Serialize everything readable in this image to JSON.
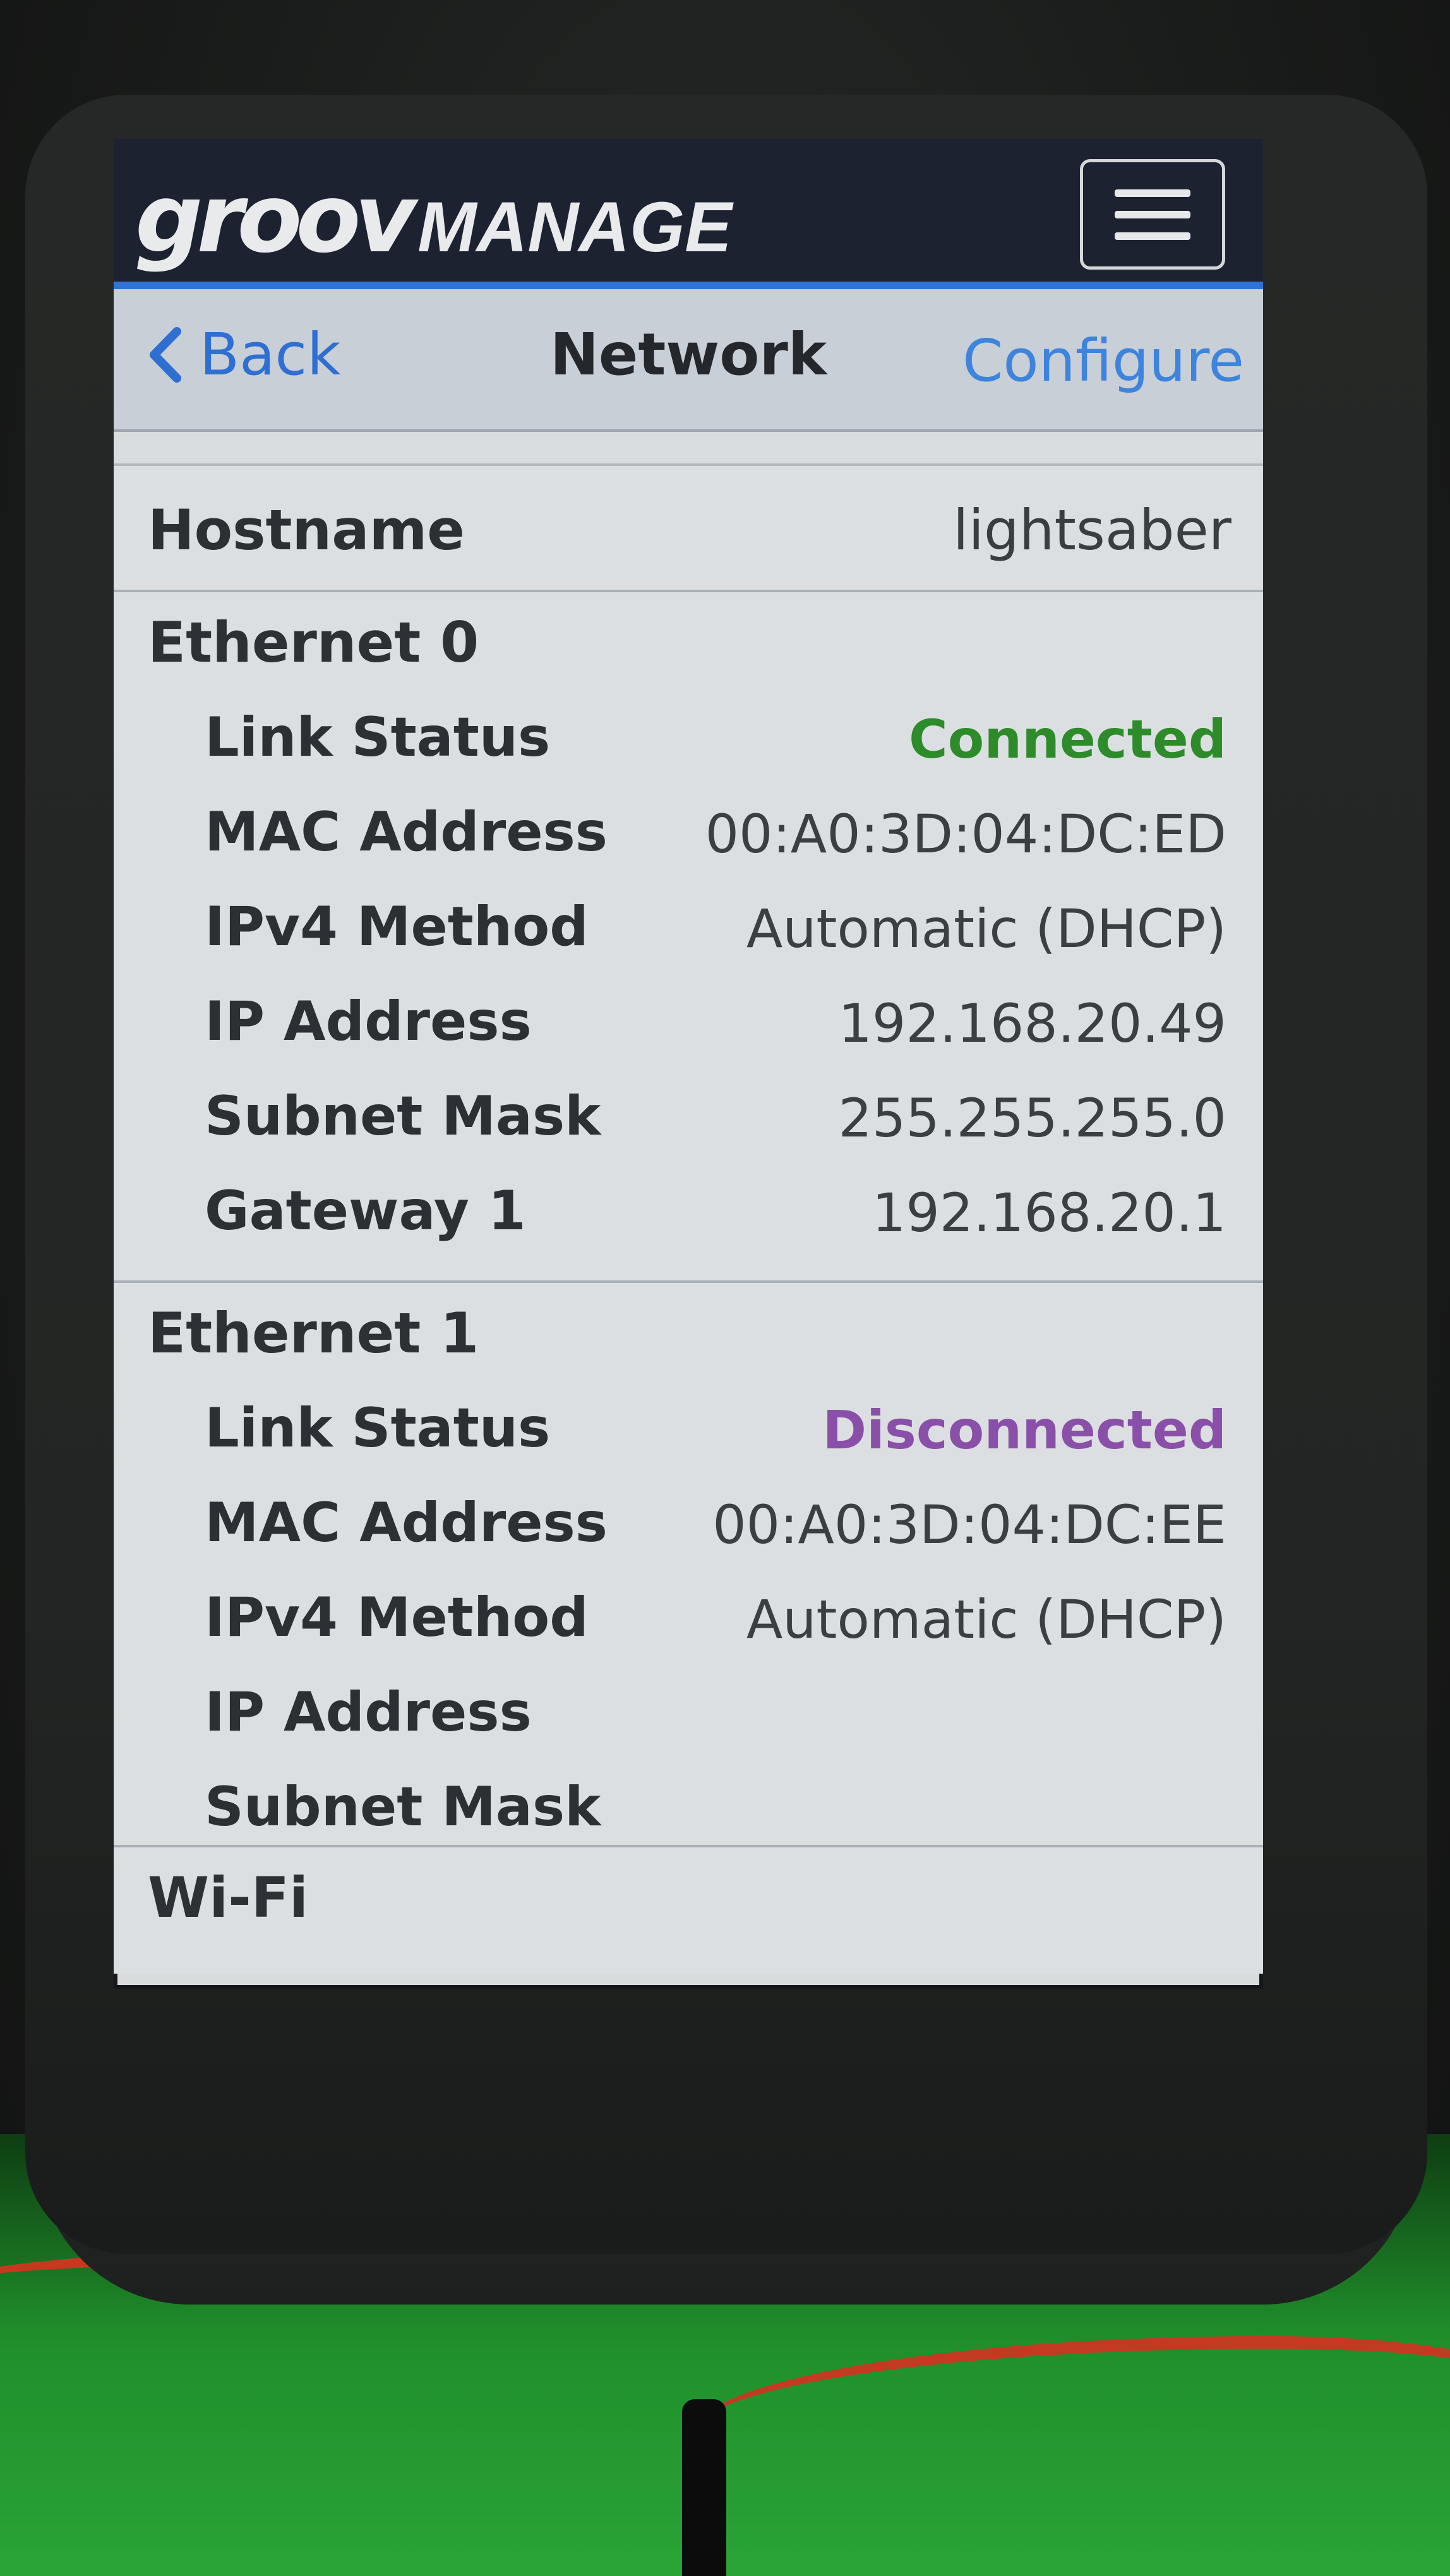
{
  "app": {
    "brand_part1": "groov",
    "brand_part2": "MANAGE",
    "menu_icon": "hamburger-menu-icon"
  },
  "nav": {
    "back_label": "Back",
    "title": "Network",
    "configure_label": "Configure"
  },
  "hostname": {
    "label": "Hostname",
    "value": "lightsaber"
  },
  "ethernet0": {
    "title": "Ethernet 0",
    "fields": [
      {
        "label": "Link Status",
        "value": "Connected"
      },
      {
        "label": "MAC Address",
        "value": "00:A0:3D:04:DC:ED"
      },
      {
        "label": "IPv4 Method",
        "value": "Automatic (DHCP)"
      },
      {
        "label": "IP Address",
        "value": "192.168.20.49"
      },
      {
        "label": "Subnet Mask",
        "value": "255.255.255.0"
      },
      {
        "label": "Gateway 1",
        "value": "192.168.20.1"
      }
    ]
  },
  "ethernet1": {
    "title": "Ethernet 1",
    "fields": [
      {
        "label": "Link Status",
        "value": "Disconnected"
      },
      {
        "label": "MAC Address",
        "value": "00:A0:3D:04:DC:EE"
      },
      {
        "label": "IPv4 Method",
        "value": "Automatic (DHCP)"
      },
      {
        "label": "IP Address",
        "value": ""
      },
      {
        "label": "Subnet Mask",
        "value": ""
      }
    ]
  },
  "wifi": {
    "title": "Wi-Fi"
  },
  "colors": {
    "app_bar": "#1c2230",
    "accent": "#2e74d6",
    "link": "#2f6fd1",
    "connected": "#2e8b2a",
    "disconnected": "#8a4fa8"
  }
}
